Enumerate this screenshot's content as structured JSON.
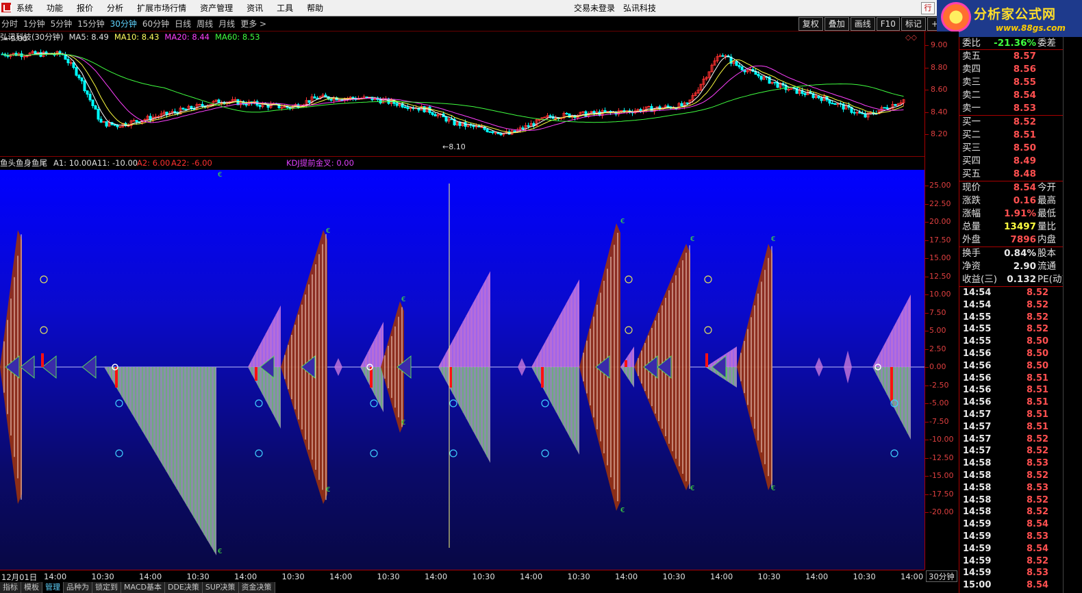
{
  "menubar": {
    "items": [
      "系统",
      "功能",
      "报价",
      "分析",
      "扩展市场行情",
      "资产管理",
      "资讯",
      "工具",
      "帮助"
    ],
    "login_status": "交易未登录",
    "stock_name": "弘讯科技",
    "window_button": "行"
  },
  "periodbar": {
    "items": [
      "分时",
      "1分钟",
      "5分钟",
      "15分钟",
      "30分钟",
      "60分钟",
      "日线",
      "周线",
      "月线",
      "更多 >"
    ],
    "active": "30分钟",
    "tools": [
      "复权",
      "叠加",
      "画线",
      "F10",
      "标记",
      "+自选"
    ]
  },
  "watermark": {
    "title": "分析家公式网",
    "url": "www.88gs.com"
  },
  "main_legend": [
    {
      "text": "弘讯科技(30分钟)",
      "color": "#e0e0e0"
    },
    {
      "text": "MA5: 8.49",
      "color": "#e0e0e0"
    },
    {
      "text": "MA10: 8.43",
      "color": "#ffff60"
    },
    {
      "text": "MA20: 8.44",
      "color": "#ff40ff"
    },
    {
      "text": "MA60: 8.53",
      "color": "#40ff40"
    }
  ],
  "main_chart": {
    "price_axis": [
      "9.00",
      "8.80",
      "8.60",
      "8.40",
      "8.20"
    ],
    "high_label": "9.00",
    "low_label": "8.10",
    "colors": {
      "up": "#ff3030",
      "down": "#00ffff",
      "ma5": "#ffffff",
      "ma10": "#ffff40",
      "ma20": "#ff40ff",
      "ma60": "#40ff40"
    }
  },
  "indicator": {
    "name": "鱼头鱼身鱼尾",
    "a1": "A1: 10.00",
    "a11": "A11: -10.00",
    "a2": "A2: 6.00",
    "a22": "A22: -6.00",
    "kdj": "KDJ提前金叉: 0.00",
    "axis": [
      "25.00",
      "22.50",
      "20.00",
      "17.50",
      "15.00",
      "12.50",
      "10.00",
      "7.50",
      "5.00",
      "2.50",
      "0.00",
      "-2.50",
      "-5.00",
      "-7.50",
      "-10.00",
      "-12.50",
      "-15.00",
      "-17.50",
      "-20.00"
    ],
    "colors": {
      "purple": "#c878dc",
      "brown": "#9a3210",
      "green": "#50c850",
      "gray": "#9a9ab0"
    }
  },
  "time_axis": [
    "12月01日",
    "14:00",
    "10:30",
    "14:00",
    "10:30",
    "14:00",
    "10:30",
    "14:00",
    "10:30",
    "14:00",
    "10:30",
    "14:00",
    "10:30",
    "14:00",
    "10:30",
    "14:00",
    "10:30",
    "14:00",
    "10:30",
    "14:00"
  ],
  "period_indicator": "30分钟",
  "bottom_tabs": [
    "指标",
    "模板",
    "管理",
    "品种为",
    "锁定到",
    "MACD基本",
    "DDE决策",
    "SUP决策",
    "资金决策"
  ],
  "bottom_active": "管理",
  "quote": {
    "ratio": {
      "label": "委比",
      "value": "-21.36%",
      "label2": "委差"
    },
    "asks": [
      {
        "label": "卖五",
        "price": "8.57"
      },
      {
        "label": "卖四",
        "price": "8.56"
      },
      {
        "label": "卖三",
        "price": "8.55"
      },
      {
        "label": "卖二",
        "price": "8.54"
      },
      {
        "label": "卖一",
        "price": "8.53"
      }
    ],
    "bids": [
      {
        "label": "买一",
        "price": "8.52"
      },
      {
        "label": "买二",
        "price": "8.51"
      },
      {
        "label": "买三",
        "price": "8.50"
      },
      {
        "label": "买四",
        "price": "8.49"
      },
      {
        "label": "买五",
        "price": "8.48"
      }
    ],
    "stats": [
      {
        "label": "现价",
        "value": "8.54",
        "color": "#ff5050",
        "label2": "今开"
      },
      {
        "label": "涨跌",
        "value": "0.16",
        "color": "#ff5050",
        "label2": "最高"
      },
      {
        "label": "涨幅",
        "value": "1.91%",
        "color": "#ff5050",
        "label2": "最低"
      },
      {
        "label": "总量",
        "value": "13497",
        "color": "#ffff40",
        "label2": "量比"
      },
      {
        "label": "外盘",
        "value": "7896",
        "color": "#ff5050",
        "label2": "内盘"
      }
    ],
    "fundamentals": [
      {
        "label": "换手",
        "value": "0.84%",
        "label2": "股本"
      },
      {
        "label": "净资",
        "value": "2.90",
        "label2": "流通"
      },
      {
        "label": "收益(三)",
        "value": "0.132",
        "label2": "PE(动)"
      }
    ],
    "ticks": [
      {
        "time": "14:54",
        "price": "8.52"
      },
      {
        "time": "14:54",
        "price": "8.52"
      },
      {
        "time": "14:55",
        "price": "8.52"
      },
      {
        "time": "14:55",
        "price": "8.52"
      },
      {
        "time": "14:55",
        "price": "8.50"
      },
      {
        "time": "14:56",
        "price": "8.50"
      },
      {
        "time": "14:56",
        "price": "8.50"
      },
      {
        "time": "14:56",
        "price": "8.51"
      },
      {
        "time": "14:56",
        "price": "8.51"
      },
      {
        "time": "14:56",
        "price": "8.51"
      },
      {
        "time": "14:57",
        "price": "8.51"
      },
      {
        "time": "14:57",
        "price": "8.51"
      },
      {
        "time": "14:57",
        "price": "8.52"
      },
      {
        "time": "14:57",
        "price": "8.52"
      },
      {
        "time": "14:58",
        "price": "8.53"
      },
      {
        "time": "14:58",
        "price": "8.52"
      },
      {
        "time": "14:58",
        "price": "8.53"
      },
      {
        "time": "14:58",
        "price": "8.52"
      },
      {
        "time": "14:58",
        "price": "8.52"
      },
      {
        "time": "14:59",
        "price": "8.54"
      },
      {
        "time": "14:59",
        "price": "8.53"
      },
      {
        "time": "14:59",
        "price": "8.54"
      },
      {
        "time": "14:59",
        "price": "8.52"
      },
      {
        "time": "14:59",
        "price": "8.53"
      },
      {
        "time": "15:00",
        "price": "8.54"
      }
    ]
  }
}
